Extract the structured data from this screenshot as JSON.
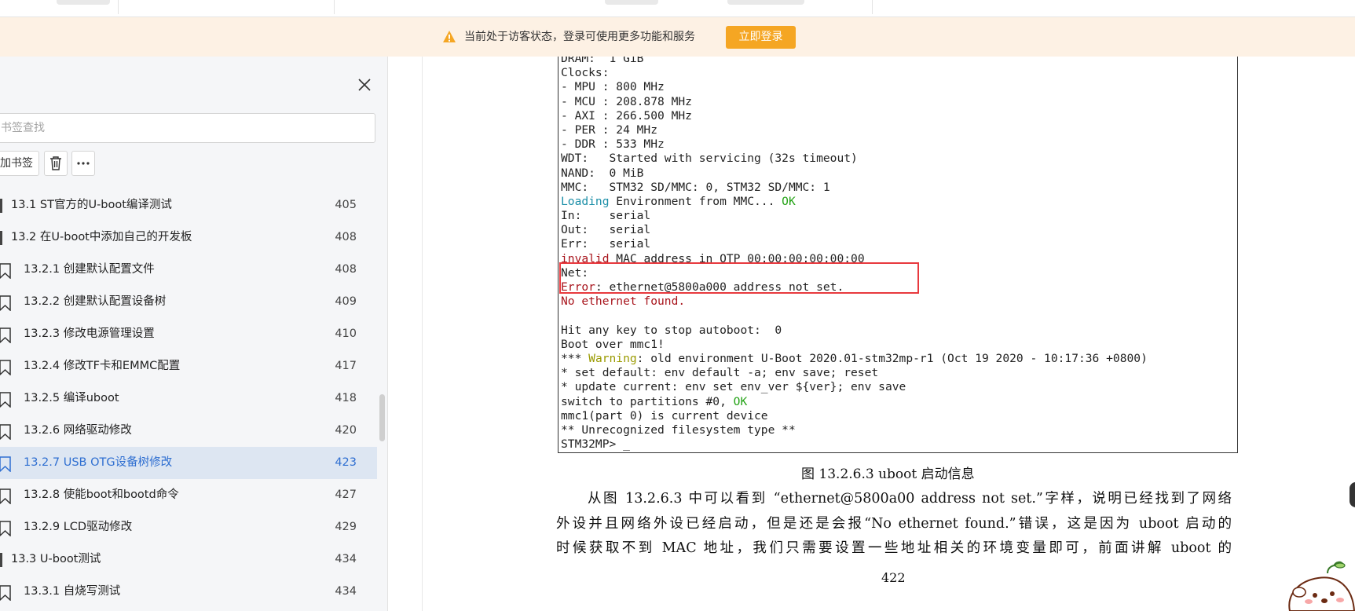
{
  "banner": {
    "message": "当前处于访客状态，登录可使用更多功能和服务",
    "login_button": "立即登录"
  },
  "sidebar": {
    "search_placeholder": "书签查找",
    "add_bookmark_label": "加书签",
    "toc": [
      {
        "label": "13.1 ST官方的U-boot编译测试",
        "page": "405",
        "level": 2,
        "active": false
      },
      {
        "label": "13.2 在U-boot中添加自己的开发板",
        "page": "408",
        "level": 2,
        "active": false
      },
      {
        "label": "13.2.1 创建默认配置文件",
        "page": "408",
        "level": 3,
        "active": false
      },
      {
        "label": "13.2.2 创建默认配置设备树",
        "page": "409",
        "level": 3,
        "active": false
      },
      {
        "label": "13.2.3 修改电源管理设置",
        "page": "410",
        "level": 3,
        "active": false
      },
      {
        "label": "13.2.4 修改TF卡和EMMC配置",
        "page": "417",
        "level": 3,
        "active": false
      },
      {
        "label": "13.2.5 编译uboot",
        "page": "418",
        "level": 3,
        "active": false
      },
      {
        "label": "13.2.6 网络驱动修改",
        "page": "420",
        "level": 3,
        "active": false
      },
      {
        "label": "13.2.7 USB OTG设备树修改",
        "page": "423",
        "level": 3,
        "active": true
      },
      {
        "label": "13.2.8 使能boot和bootd命令",
        "page": "427",
        "level": 3,
        "active": false
      },
      {
        "label": "13.2.9 LCD驱动修改",
        "page": "429",
        "level": 3,
        "active": false
      },
      {
        "label": "13.3 U-boot测试",
        "page": "434",
        "level": 2,
        "active": false
      },
      {
        "label": "13.3.1 自烧写测试",
        "page": "434",
        "level": 3,
        "active": false
      }
    ]
  },
  "document": {
    "terminal": {
      "lines": [
        [
          {
            "t": "DRAM:  1 GiB",
            "c": ""
          }
        ],
        [
          {
            "t": "Clocks:",
            "c": ""
          }
        ],
        [
          {
            "t": "- MPU : 800 MHz",
            "c": ""
          }
        ],
        [
          {
            "t": "- MCU : 208.878 MHz",
            "c": ""
          }
        ],
        [
          {
            "t": "- AXI : 266.500 MHz",
            "c": ""
          }
        ],
        [
          {
            "t": "- PER : 24 MHz",
            "c": ""
          }
        ],
        [
          {
            "t": "- DDR : 533 MHz",
            "c": ""
          }
        ],
        [
          {
            "t": "WDT:   Started with servicing (32s timeout)",
            "c": ""
          }
        ],
        [
          {
            "t": "NAND:  0 MiB",
            "c": ""
          }
        ],
        [
          {
            "t": "MMC:   STM32 SD/MMC: 0, STM32 SD/MMC: 1",
            "c": ""
          }
        ],
        [
          {
            "t": "Loading",
            "c": "cyan"
          },
          {
            "t": " Environment from MMC... ",
            "c": ""
          },
          {
            "t": "OK",
            "c": "green"
          }
        ],
        [
          {
            "t": "In:    serial",
            "c": ""
          }
        ],
        [
          {
            "t": "Out:   serial",
            "c": ""
          }
        ],
        [
          {
            "t": "Err:   serial",
            "c": ""
          }
        ],
        [
          {
            "t": "invalid",
            "c": "red"
          },
          {
            "t": " MAC address in OTP 00:00:00:00:00:00",
            "c": ""
          }
        ],
        [
          {
            "t": "Net:",
            "c": ""
          }
        ],
        [
          {
            "t": "Error",
            "c": "red"
          },
          {
            "t": ": ethernet@5800a000 address not set.",
            "c": ""
          }
        ],
        [
          {
            "t": "No ethernet found.",
            "c": "red"
          }
        ],
        [
          {
            "t": "",
            "c": ""
          }
        ],
        [
          {
            "t": "Hit any key to stop autoboot:  0",
            "c": ""
          }
        ],
        [
          {
            "t": "Boot over mmc1!",
            "c": ""
          }
        ],
        [
          {
            "t": "*** ",
            "c": ""
          },
          {
            "t": "Warning",
            "c": "amber"
          },
          {
            "t": ": old environment U-Boot 2020.01-stm32mp-r1 (Oct 19 2020 - 10:17:36 +0800)",
            "c": ""
          }
        ],
        [
          {
            "t": "* set default: env default -a; env save; reset",
            "c": ""
          }
        ],
        [
          {
            "t": "* update current: env set env_ver ${ver}; env save",
            "c": ""
          }
        ],
        [
          {
            "t": "switch to partitions #0, ",
            "c": ""
          },
          {
            "t": "OK",
            "c": "green"
          }
        ],
        [
          {
            "t": "mmc1(part 0) is current device",
            "c": ""
          }
        ],
        [
          {
            "t": "** Unrecognized filesystem type **",
            "c": ""
          }
        ],
        [
          {
            "t": "STM32MP> _",
            "c": ""
          }
        ]
      ]
    },
    "caption": "图 13.2.6.3 uboot 启动信息",
    "paragraph_lines": [
      "从图 13.2.6.3 中可以看到 “ethernet@5800a00 address not set.”字样，说明已经找到了网络",
      "外设并且网络外设已经启动，但是还是会报“No ethernet found.”错误，这是因为 uboot 启动的",
      "时候获取不到 MAC 地址，我们只需要设置一些地址相关的环境变量即可，前面讲解 uboot 的"
    ],
    "page_number": "422"
  },
  "colors": {
    "banner_bg": "#fdf1e4",
    "login_button": "#f5a623",
    "active_toc_bg": "#dde6f2",
    "active_toc_text": "#2f6fd1",
    "highlight_box": "#e8393e"
  }
}
